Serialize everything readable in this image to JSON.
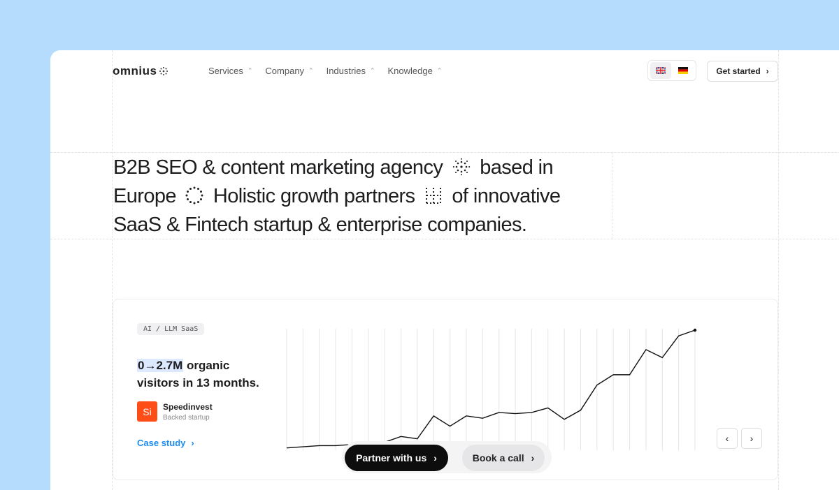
{
  "brand": {
    "logo_text": "omnius"
  },
  "nav": {
    "items": [
      {
        "label": "Services"
      },
      {
        "label": "Company"
      },
      {
        "label": "Industries"
      },
      {
        "label": "Knowledge"
      }
    ]
  },
  "language": {
    "options": [
      "en",
      "de"
    ],
    "selected": "en"
  },
  "header": {
    "cta_label": "Get started"
  },
  "hero": {
    "line1_a": "B2B SEO & content marketing agency",
    "line1_b": "based in",
    "line2_a": "Europe",
    "line2_b": "Holistic growth partners",
    "line2_c": "of innovative",
    "line3": "SaaS & Fintech startup & enterprise companies."
  },
  "case_card": {
    "tag": "AI / LLM SaaS",
    "stat_highlight": "0→2.7M",
    "stat_rest": " organic",
    "stat_line2": "visitors in 13 months.",
    "company_initials": "Si",
    "company_name": "Speedinvest",
    "company_sub": "Backed startup",
    "link_label": "Case study"
  },
  "chart_data": {
    "type": "line",
    "values": [
      0.02,
      0.03,
      0.04,
      0.04,
      0.05,
      0.07,
      0.07,
      0.12,
      0.1,
      0.3,
      0.21,
      0.3,
      0.28,
      0.33,
      0.32,
      0.33,
      0.37,
      0.27,
      0.35,
      0.57,
      0.66,
      0.66,
      0.88,
      0.81,
      1.0,
      1.05
    ],
    "grid_vertical": true
  },
  "bottom_cta": {
    "primary_label": "Partner with us",
    "secondary_label": "Book a call"
  },
  "colors": {
    "page_bg": "#b5dcfd",
    "accent_link": "#1d8cf0",
    "brand_orange": "#ff4d17",
    "highlight": "#dce9ff"
  }
}
